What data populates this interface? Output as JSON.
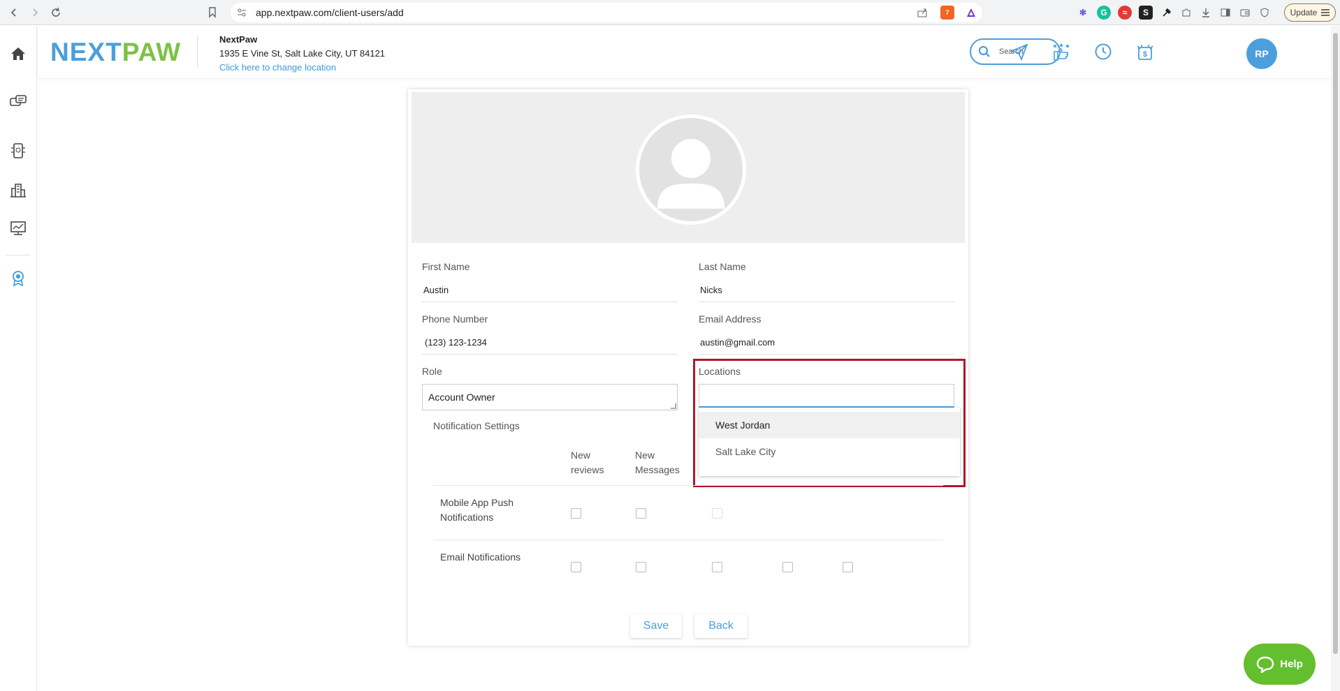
{
  "browser": {
    "url": "app.nextpaw.com/client-users/add",
    "update_label": "Update",
    "brave_badge": "7"
  },
  "header": {
    "logo_next": "NEXT",
    "logo_paw": "PAW",
    "business_name": "NextPaw",
    "business_address": "1935 E Vine St, Salt Lake City, UT 84121",
    "change_location_link": "Click here to change location",
    "search_placeholder": "Search",
    "avatar_initials": "RP"
  },
  "form": {
    "first_name_label": "First Name",
    "first_name_value": "Austin",
    "last_name_label": "Last Name",
    "last_name_value": "Nicks",
    "phone_label": "Phone Number",
    "phone_value": "(123) 123-1234",
    "email_label": "Email Address",
    "email_value": "austin@gmail.com",
    "role_label": "Role",
    "role_value": "Account Owner",
    "locations_label": "Locations",
    "locations_value": "",
    "location_options": [
      "West Jordan",
      "Salt Lake City"
    ]
  },
  "notifications": {
    "title": "Notification Settings",
    "columns": [
      "New reviews",
      "New Messages"
    ],
    "col_reviews_line1": "New",
    "col_reviews_line2": "reviews",
    "col_messages_line1": "New",
    "col_messages_line2": "Messages",
    "rows": [
      {
        "label_line1": "Mobile App Push",
        "label_line2": "Notifications"
      },
      {
        "label_line1": "Email Notifications",
        "label_line2": ""
      }
    ]
  },
  "actions": {
    "save_label": "Save",
    "back_label": "Back"
  },
  "help": {
    "label": "Help"
  },
  "colors": {
    "brand_blue": "#4a9fdc",
    "brand_green": "#7cc242",
    "highlight_red": "#b0182a",
    "help_green": "#64bf2f"
  }
}
